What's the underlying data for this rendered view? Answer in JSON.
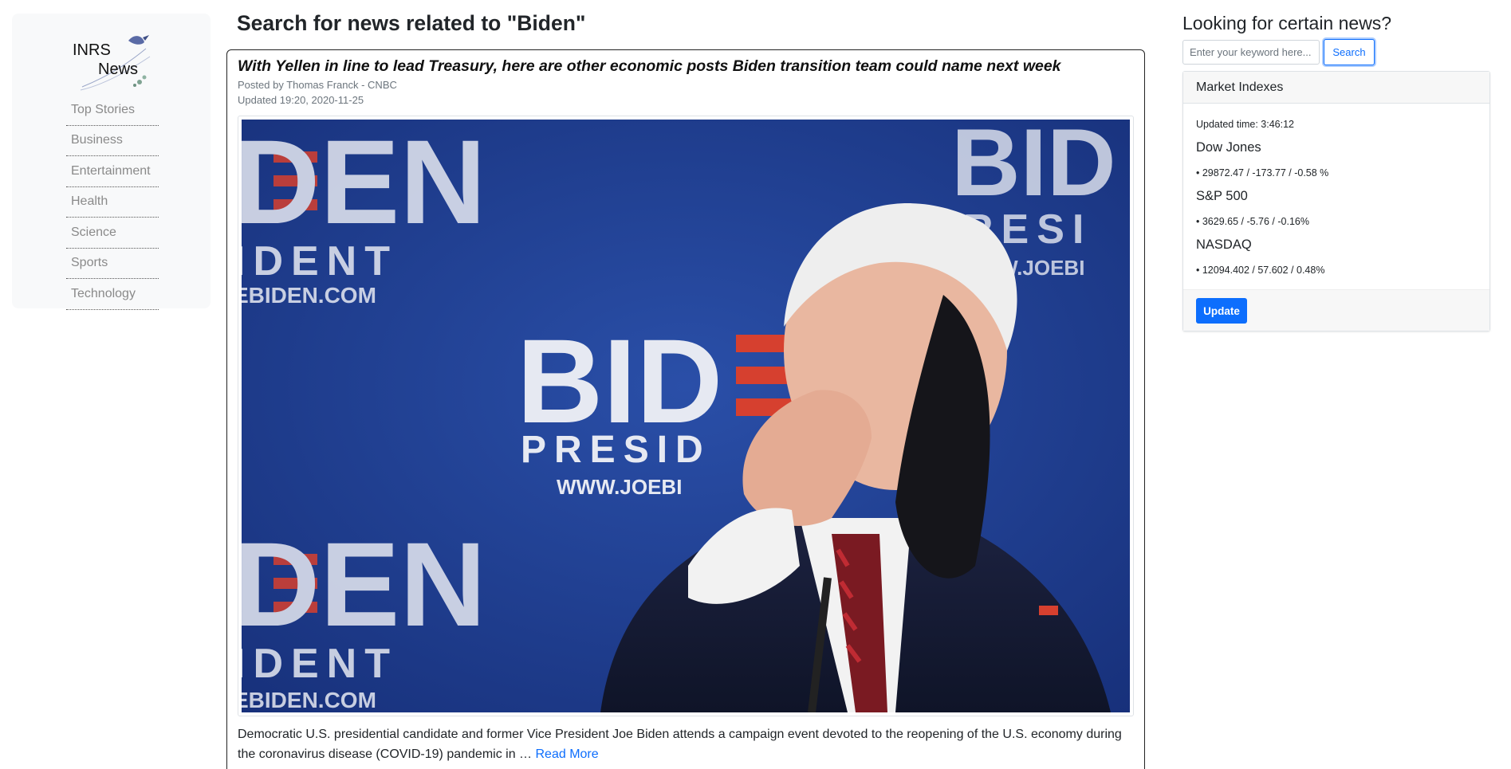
{
  "brand": {
    "logo_line1": "INRS",
    "logo_line2": "News"
  },
  "sidebar": {
    "items": [
      {
        "label": "Top Stories"
      },
      {
        "label": "Business"
      },
      {
        "label": "Entertainment"
      },
      {
        "label": "Health"
      },
      {
        "label": "Science"
      },
      {
        "label": "Sports"
      },
      {
        "label": "Technology"
      }
    ]
  },
  "main": {
    "title": "Search for news related to \"Biden\"",
    "article": {
      "title": "With Yellen in line to lead Treasury, here are other economic posts Biden transition team could name next week",
      "posted_by": "Posted by Thomas Franck - CNBC",
      "updated": "Updated 19:20, 2020-11-25",
      "excerpt": "Democratic U.S. presidential candidate and former Vice President Joe Biden attends a campaign event devoted to the reopening of the U.S. economy during the coronavirus disease (COVID-19) pandemic in … ",
      "read_more": "Read More",
      "image_text": {
        "big": "BIDEN",
        "president": "PRESIDENT",
        "url": "WWW.JOEBIDEN.COM"
      }
    }
  },
  "right": {
    "search_heading": "Looking for certain news?",
    "search_placeholder": "Enter your keyword here...",
    "search_button": "Search",
    "market": {
      "header": "Market Indexes",
      "updated_time": "Updated time: 3:46:12",
      "indexes": [
        {
          "name": "Dow Jones",
          "value": "• 29872.47 / -173.77 / -0.58 %"
        },
        {
          "name": "S&P 500",
          "value": "• 3629.65 / -5.76 / -0.16%"
        },
        {
          "name": "NASDAQ",
          "value": "• 12094.402 / 57.602 / 0.48%"
        }
      ],
      "update_button": "Update"
    }
  },
  "colors": {
    "accent": "#0d6efd",
    "sidebar_bg": "#f8f9fa",
    "backdrop_blue": "#1f3f8f",
    "stripe_red": "#d6402f"
  }
}
